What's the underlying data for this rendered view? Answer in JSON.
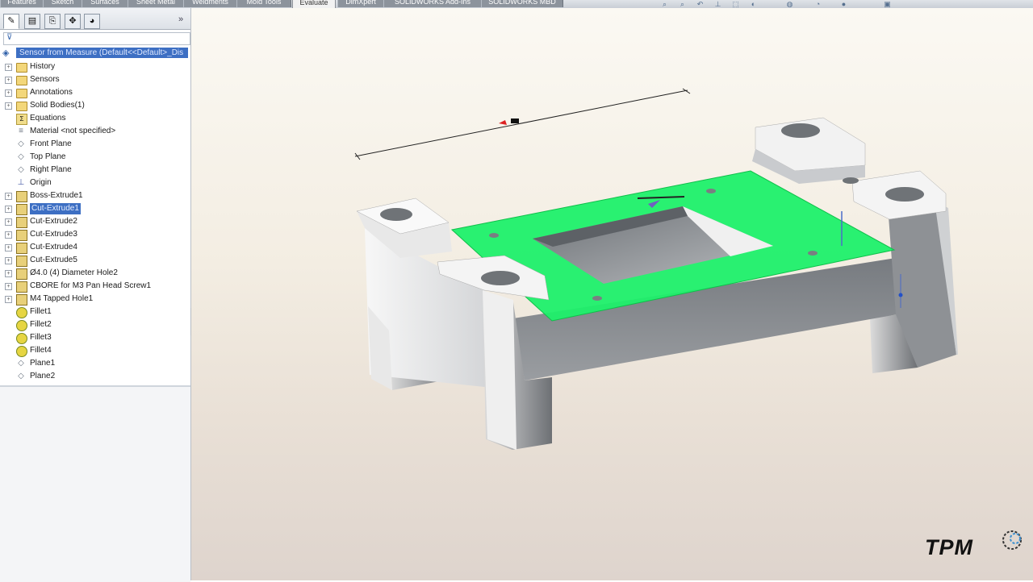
{
  "toolbar": {
    "tabs": [
      "Features",
      "Sketch",
      "Surfaces",
      "Sheet Metal",
      "Weldments",
      "Mold Tools",
      "Evaluate",
      "DimXpert",
      "SOLIDWORKS Add-Ins",
      "SOLIDWORKS MBD"
    ],
    "active_tab": "Evaluate"
  },
  "hud_icons": [
    "zoom-to-fit-icon",
    "zoom-to-area-icon",
    "previous-view-icon",
    "section-view-icon",
    "view-orientation-icon",
    "display-style-icon",
    "hide-show-icon",
    "edit-appearance-icon",
    "apply-scene-icon",
    "view-settings-icon"
  ],
  "feature_manager": {
    "panel_tabs": [
      "feature-manager-tab",
      "property-manager-tab",
      "configuration-manager-tab",
      "dimxpert-manager-tab",
      "display-manager-tab"
    ],
    "expand_glyph": "»",
    "filter_glyph": "⊽",
    "root_label": "Sensor from Measure  (Default<<Default>_Dis",
    "items": [
      {
        "label": "History",
        "icon": "folder",
        "expand": "+"
      },
      {
        "label": "Sensors",
        "icon": "folder",
        "expand": "+"
      },
      {
        "label": "Annotations",
        "icon": "folder",
        "expand": "+"
      },
      {
        "label": "Solid Bodies(1)",
        "icon": "folder",
        "expand": "+"
      },
      {
        "label": "Equations",
        "icon": "eq",
        "expand": ""
      },
      {
        "label": "Material <not specified>",
        "icon": "material",
        "expand": ""
      },
      {
        "label": "Front Plane",
        "icon": "plane",
        "expand": ""
      },
      {
        "label": "Top Plane",
        "icon": "plane",
        "expand": ""
      },
      {
        "label": "Right Plane",
        "icon": "plane",
        "expand": ""
      },
      {
        "label": "Origin",
        "icon": "origin",
        "expand": ""
      },
      {
        "label": "Boss-Extrude1",
        "icon": "feat",
        "expand": "+"
      },
      {
        "label": "Cut-Extrude1",
        "icon": "feat",
        "expand": "+",
        "selected": true
      },
      {
        "label": "Cut-Extrude2",
        "icon": "feat",
        "expand": "+"
      },
      {
        "label": "Cut-Extrude3",
        "icon": "feat",
        "expand": "+"
      },
      {
        "label": "Cut-Extrude4",
        "icon": "feat",
        "expand": "+"
      },
      {
        "label": "Cut-Extrude5",
        "icon": "feat",
        "expand": "+"
      },
      {
        "label": "Ø4.0 (4) Diameter Hole2",
        "icon": "feat",
        "expand": "+"
      },
      {
        "label": "CBORE for M3 Pan Head Screw1",
        "icon": "feat",
        "expand": "+"
      },
      {
        "label": "M4 Tapped Hole1",
        "icon": "feat",
        "expand": "+"
      },
      {
        "label": "Fillet1",
        "icon": "fillet",
        "expand": ""
      },
      {
        "label": "Fillet2",
        "icon": "fillet",
        "expand": ""
      },
      {
        "label": "Fillet3",
        "icon": "fillet",
        "expand": ""
      },
      {
        "label": "Fillet4",
        "icon": "fillet",
        "expand": ""
      },
      {
        "label": "Plane1",
        "icon": "plane",
        "expand": ""
      },
      {
        "label": "Plane2",
        "icon": "plane",
        "expand": ""
      }
    ]
  },
  "viewport": {
    "dimension_value": "9",
    "logo_text": "TPM",
    "colors": {
      "highlight_face": "#1ef06a",
      "part": "#e6e6e6",
      "background_top": "#fbf9f3",
      "background_bottom": "#ded4cd"
    }
  }
}
